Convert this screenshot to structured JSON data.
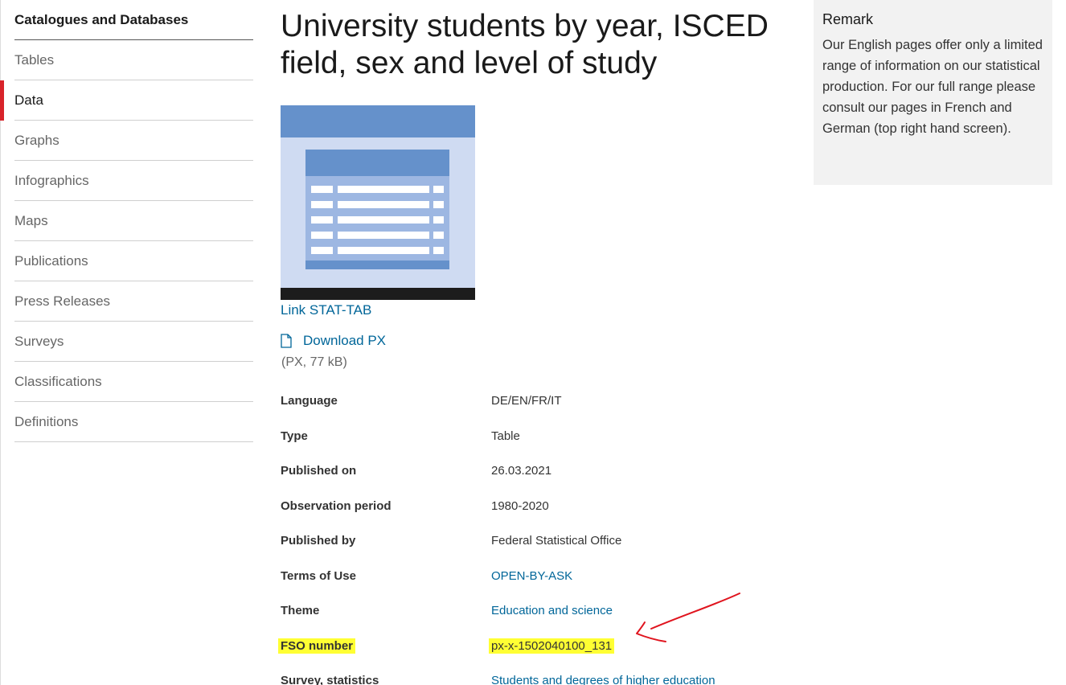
{
  "sidebar": {
    "items": [
      {
        "label": "Catalogues and Databases"
      },
      {
        "label": "Tables"
      },
      {
        "label": "Data"
      },
      {
        "label": "Graphs"
      },
      {
        "label": "Infographics"
      },
      {
        "label": "Maps"
      },
      {
        "label": "Publications"
      },
      {
        "label": "Press Releases"
      },
      {
        "label": "Surveys"
      },
      {
        "label": "Classifications"
      },
      {
        "label": "Definitions"
      }
    ],
    "active_item": "Data"
  },
  "main": {
    "title": "University students by year, ISCED field, sex and level of study",
    "stattab_link": "Link STAT-TAB",
    "download_label": "Download PX",
    "file_meta": "(PX, 77 kB)",
    "details": [
      {
        "label": "Language",
        "value": "DE/EN/FR/IT"
      },
      {
        "label": "Type",
        "value": "Table"
      },
      {
        "label": "Published on",
        "value": "26.03.2021"
      },
      {
        "label": "Observation period",
        "value": "1980-2020"
      },
      {
        "label": "Published by",
        "value": "Federal Statistical Office"
      },
      {
        "label": "Terms of Use",
        "value": "OPEN-BY-ASK"
      },
      {
        "label": "Theme",
        "value": "Education and science"
      },
      {
        "label": "FSO number",
        "value": "px-x-1502040100_131"
      },
      {
        "label": "Survey, statistics",
        "value": "Students and degrees of higher education"
      }
    ]
  },
  "remark": {
    "title": "Remark",
    "text": "Our English pages offer only a limited range of information on our statistical production. For our full range please consult our pages in French and German (top right hand screen)."
  },
  "colors": {
    "accent_red": "#d8232a",
    "link_blue": "#006699",
    "highlight_yellow": "#ffff33",
    "annotation_red": "#e0141e"
  },
  "icons": {
    "download": "document-icon",
    "annotation": "arrow-icon"
  }
}
